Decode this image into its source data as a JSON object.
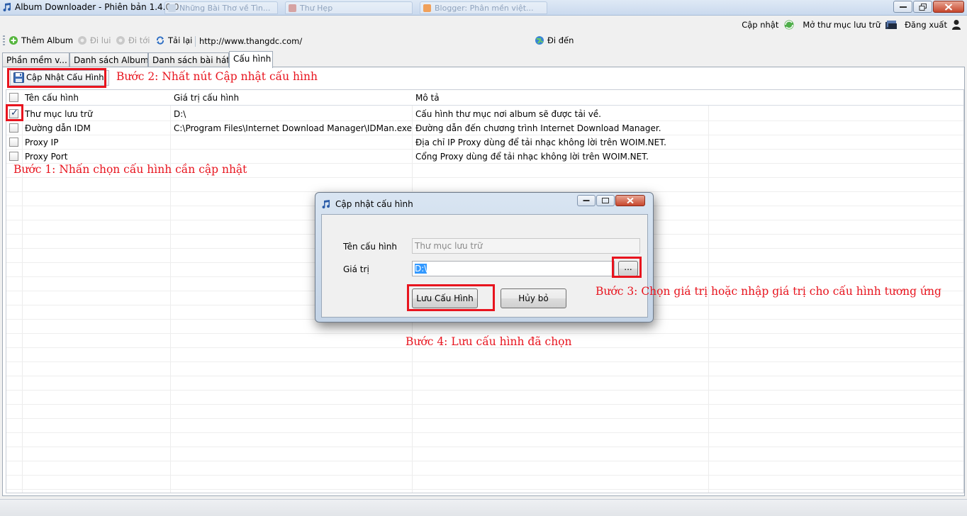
{
  "window": {
    "title": "Album Downloader - Phiên bản 1.4.0.0",
    "background_tabs": [
      "Những Bài Thơ về Tìn...",
      "Thư Hẹp",
      "Blogger: Phân mền việt..."
    ]
  },
  "header_links": {
    "update": "Cập nhật",
    "open_folder": "Mở thư mục lưu trữ",
    "logout": "Đăng xuất"
  },
  "toolbar": {
    "add_album": "Thêm Album",
    "back": "Đi lui",
    "forward": "Đi tới",
    "reload": "Tải lại",
    "url": "http://www.thangdc.com/",
    "go": "Đi đến"
  },
  "tabs": [
    "Phần mềm v...",
    "Danh sách Album",
    "Danh sách bài hát",
    "Cấu hình"
  ],
  "active_tab": 3,
  "config": {
    "update_button": "Cập Nhật Cấu Hình",
    "columns": [
      "Tên cấu hình",
      "Giá trị cấu hình",
      "Mô tả"
    ],
    "rows": [
      {
        "checked": true,
        "name": "Thư mục lưu trữ",
        "value": "D:\\",
        "desc": "Cấu hình thư mục nơi album sẽ được tải về."
      },
      {
        "checked": false,
        "name": "Đường dẫn IDM",
        "value": "C:\\Program Files\\Internet Download Manager\\IDMan.exe",
        "desc": "Đường dẫn đến chương trình Internet Download Manager."
      },
      {
        "checked": false,
        "name": "Proxy IP",
        "value": "",
        "desc": "Địa chỉ IP Proxy dùng để tải nhạc không lời trên WOIM.NET."
      },
      {
        "checked": false,
        "name": "Proxy Port",
        "value": "",
        "desc": "Cổng Proxy dùng để tải nhạc không lời trên WOIM.NET."
      }
    ]
  },
  "annotations": {
    "step1": "Bước 1: Nhấn chọn cấu hình cần cập nhật",
    "step2": "Bước 2: Nhất nút Cập nhật cấu hình",
    "step3": "Bước 3: Chọn giá trị hoặc nhập giá trị cho cấu hình tương ứng",
    "step4": "Bước 4: Lưu cấu hình đã chọn",
    "color": "#e8141e"
  },
  "dialog": {
    "title": "Cập nhật cấu hình",
    "name_label": "Tên cấu hình",
    "name_value": "Thư mục lưu trữ",
    "value_label": "Giá trị",
    "value_value": "D:\\",
    "browse": "...",
    "save": "Lưu Cấu Hình",
    "cancel": "Hủy bỏ"
  }
}
